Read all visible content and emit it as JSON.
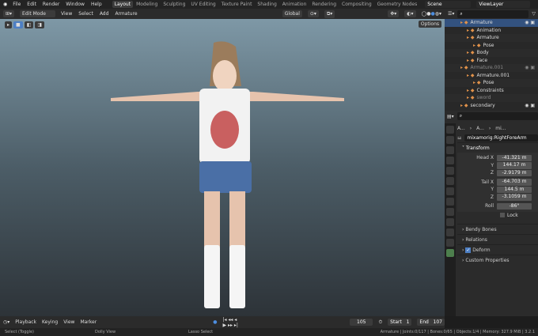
{
  "menu": [
    "File",
    "Edit",
    "Render",
    "Window",
    "Help"
  ],
  "workspaces": [
    "Layout",
    "Modeling",
    "Sculpting",
    "UV Editing",
    "Texture Paint",
    "Shading",
    "Animation",
    "Rendering",
    "Compositing",
    "Geometry Nodes"
  ],
  "active_workspace": "Layout",
  "scene": "Scene",
  "view_layer": "ViewLayer",
  "viewport_header": {
    "mode": "Edit Mode",
    "menus": [
      "View",
      "Select",
      "Add",
      "Armature"
    ],
    "orientation": "Global",
    "options": "Options"
  },
  "outliner": [
    {
      "label": "Armature",
      "indent": 0,
      "selected": true
    },
    {
      "label": "Animation",
      "indent": 1
    },
    {
      "label": "Armature",
      "indent": 1
    },
    {
      "label": "Pose",
      "indent": 2
    },
    {
      "label": "Body",
      "indent": 1
    },
    {
      "label": "Face",
      "indent": 1
    },
    {
      "label": "Armature.001",
      "indent": 0,
      "dim": true
    },
    {
      "label": "Armature.001",
      "indent": 1
    },
    {
      "label": "Pose",
      "indent": 2
    },
    {
      "label": "Constraints",
      "indent": 1
    },
    {
      "label": "sword",
      "indent": 1,
      "dim": true
    },
    {
      "label": "secondary",
      "indent": 0
    }
  ],
  "properties": {
    "breadcrumb": [
      "A...",
      "A...",
      "mi..."
    ],
    "bone_name": "mixamorig:RightForeArm",
    "transform_label": "Transform",
    "fields": [
      {
        "label": "Head X",
        "value": "-41.321 m"
      },
      {
        "label": "Y",
        "value": "144.17 m"
      },
      {
        "label": "Z",
        "value": "-2.9179 m"
      },
      {
        "label": "Tail X",
        "value": "-64.703 m"
      },
      {
        "label": "Y",
        "value": "144.5 m"
      },
      {
        "label": "Z",
        "value": "-3.1059 m"
      },
      {
        "label": "Roll",
        "value": "-86°"
      }
    ],
    "lock": "Lock",
    "panels": [
      "Bendy Bones",
      "Relations",
      "Deform",
      "Custom Properties"
    ]
  },
  "timeline": {
    "menus": [
      "Playback",
      "Keying",
      "View",
      "Marker"
    ],
    "frame": "105",
    "start_label": "Start",
    "start": "1",
    "end_label": "End",
    "end": "107"
  },
  "status": {
    "left": "Select (Toggle)",
    "middle": "Dolly View",
    "lasso": "Lasso Select",
    "right": "Armature | Joints:0/117 | Bones:0/65 | Objects:1/4 | Memory: 327.9 MiB | 3.2.1"
  }
}
